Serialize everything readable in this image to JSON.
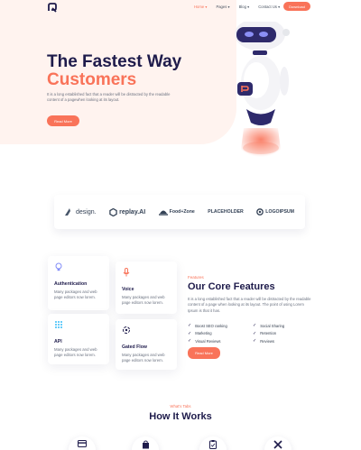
{
  "nav": {
    "links": [
      "Home",
      "Pages",
      "Blog",
      "Contact Us"
    ],
    "cta": "Download"
  },
  "hero": {
    "title_line1": "The Fastest Way",
    "title_line2": "Customers",
    "text": "It is a long established fact that a reader will be distracted by the readable content of a pagewhen looking at its layout.",
    "button": "Read More"
  },
  "brands": [
    "design.",
    "replay.AI",
    "Food+Zone",
    "PLACEHOLDER",
    "LOGOIPSUM"
  ],
  "service_cards": [
    {
      "title": "Authentication",
      "text": "Many packages and web page editors now lorem."
    },
    {
      "title": "Voice",
      "text": "Many packages and web page editors now lorem."
    },
    {
      "title": "API",
      "text": "Many packages and web page editors now lorem."
    },
    {
      "title": "Gated Flow",
      "text": "Many packages and web page editors now lorem."
    }
  ],
  "features": {
    "eyebrow": "Features",
    "title": "Our Core Features",
    "text": "It is a long established fact that a reader will be distracted by the readable content of a page when looking at its layout. The point of using Lorem Ipsum is that it has.",
    "list_left": [
      "Boost SEO ranking",
      "Marketing",
      "Visual Reviews"
    ],
    "list_right": [
      "Social Sharing",
      "Retention",
      "Reviews"
    ],
    "button": "Read More"
  },
  "how_it_works": {
    "eyebrow": "What's Tabs",
    "title": "How It Works"
  },
  "colors": {
    "accent": "#f97359",
    "navy": "#1e1b4b",
    "hero_bg": "#fff3ef"
  }
}
